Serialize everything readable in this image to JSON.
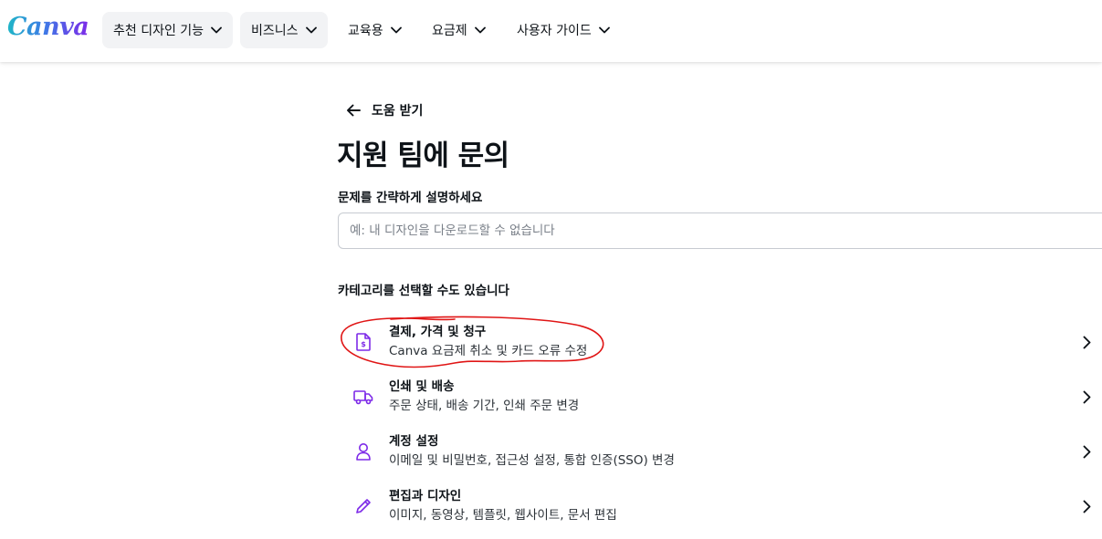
{
  "brand": {
    "logo_text": "Canva"
  },
  "nav": {
    "items": [
      {
        "label": "추천 디자인 기능"
      },
      {
        "label": "비즈니스"
      },
      {
        "label": "교육용"
      },
      {
        "label": "요금제"
      },
      {
        "label": "사용자 가이드"
      }
    ]
  },
  "back": {
    "label": "도움 받기"
  },
  "page": {
    "title": "지원 팀에 문의"
  },
  "problem": {
    "label": "문제를 간략하게 설명하세요",
    "placeholder": "예: 내 디자인을 다운로드할 수 없습니다",
    "value": ""
  },
  "categories": {
    "heading": "카테고리를 선택할 수도 있습니다",
    "items": [
      {
        "title": "결제, 가격 및 청구",
        "description": "Canva 요금제 취소 및 카드 오류 수정",
        "icon": "billing-document-icon"
      },
      {
        "title": "인쇄 및 배송",
        "description": "주문 상태, 배송 기간, 인쇄 주문 변경",
        "icon": "truck-icon"
      },
      {
        "title": "계정 설정",
        "description": "이메일 및 비밀번호, 접근성 설정, 통합 인증(SSO) 변경",
        "icon": "person-icon"
      },
      {
        "title": "편집과 디자인",
        "description": "이미지, 동영상, 템플릿, 웹사이트, 문서 편집",
        "icon": "pencil-icon"
      }
    ]
  },
  "colors": {
    "icon_accent": "#7d2ae8",
    "annotation": "#e01515",
    "text": "#0e1318"
  }
}
